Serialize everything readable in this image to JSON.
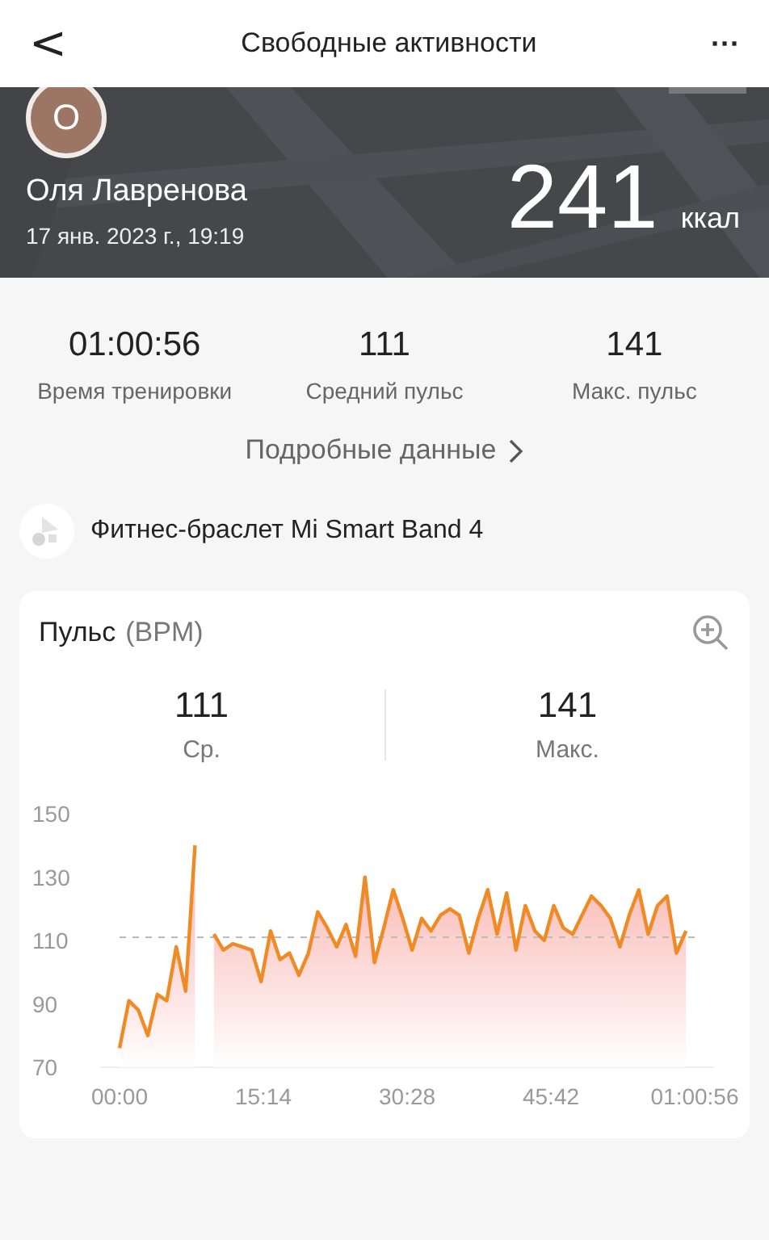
{
  "top_bar": {
    "back": "<",
    "title": "Свободные активности",
    "more": "···"
  },
  "header": {
    "kind": "picture",
    "avatar_letter": "О",
    "name": "Оля Лавренова",
    "date": "17 янв. 2023 г., 19:19",
    "calories": "241",
    "calories_unit": "ккал"
  },
  "stats": [
    {
      "value": "01:00:56",
      "label": "Время тренировки"
    },
    {
      "value": "111",
      "label": "Средний пульс"
    },
    {
      "value": "141",
      "label": "Макс. пульс"
    }
  ],
  "details_link": "Подробные данные",
  "device": {
    "name": "Фитнес-браслет Mi Smart Band 4"
  },
  "heart_card": {
    "title": "Пульс",
    "unit": "(BPM)",
    "summary": [
      {
        "value": "111",
        "label": "Ср."
      },
      {
        "value": "141",
        "label": "Макс."
      }
    ],
    "chart_data": {
      "type": "area",
      "x": [
        0,
        1,
        2,
        3,
        4,
        5,
        6,
        7,
        8,
        9,
        10,
        11,
        12,
        13,
        14,
        15,
        16,
        17,
        18,
        19,
        20,
        21,
        22,
        23,
        24,
        25,
        26,
        27,
        28,
        29,
        30,
        31,
        32,
        33,
        34,
        35,
        36,
        37,
        38,
        39,
        40,
        41,
        42,
        43,
        44,
        45,
        46,
        47,
        48,
        49,
        50,
        51,
        52,
        53,
        54,
        55,
        56,
        57,
        58,
        59,
        60
      ],
      "series": [
        {
          "color": "#f08a24",
          "values": [
            76,
            91,
            88,
            80,
            93,
            91,
            108,
            94,
            140,
            null,
            112,
            107,
            109,
            108,
            107,
            97,
            113,
            104,
            106,
            99,
            106,
            119,
            114,
            108,
            115,
            105,
            130,
            103,
            114,
            126,
            117,
            107,
            117,
            113,
            118,
            120,
            118,
            106,
            117,
            126,
            112,
            125,
            107,
            121,
            113,
            110,
            121,
            114,
            112,
            118,
            124,
            121,
            117,
            108,
            118,
            126,
            112,
            121,
            124,
            106,
            113
          ]
        }
      ],
      "xlim": [
        0,
        60.93
      ],
      "ylim": [
        70,
        150
      ],
      "yticks": [
        70,
        90,
        110,
        130,
        150
      ],
      "xticks": [
        {
          "value": 0,
          "label": "00:00"
        },
        {
          "value": 15.23,
          "label": "15:14"
        },
        {
          "value": 30.47,
          "label": "30:28"
        },
        {
          "value": 45.7,
          "label": "45:42"
        },
        {
          "value": 60.93,
          "label": "01:00:56"
        }
      ]
    }
  }
}
